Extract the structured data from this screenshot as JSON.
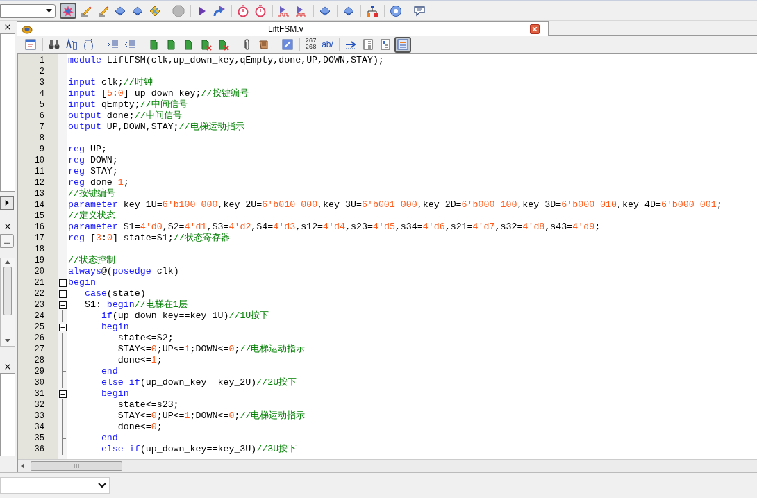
{
  "main_toolbar": {
    "buttons": [
      {
        "selected": true
      },
      {
        "selected": false
      },
      {
        "selected": false
      },
      {
        "selected": false
      },
      {
        "selected": false
      },
      {
        "selected": false
      },
      {
        "selected": false
      },
      {
        "selected": false
      },
      {
        "selected": false
      },
      {
        "selected": false
      },
      {
        "selected": false
      },
      {
        "selected": false
      },
      {
        "selected": false
      },
      {
        "selected": false
      },
      {
        "selected": false
      },
      {
        "selected": false
      },
      {
        "selected": false
      },
      {
        "selected": false
      }
    ]
  },
  "left_panel": {
    "more_button": "..."
  },
  "tab": {
    "title": "LiftFSM.v"
  },
  "editor_toolbar": {
    "buttons": [
      {
        "selected": false
      },
      {
        "selected": false
      },
      {
        "selected": false
      },
      {
        "selected": false
      },
      {
        "selected": false
      },
      {
        "selected": false
      },
      {
        "selected": false
      },
      {
        "selected": false
      },
      {
        "selected": false
      },
      {
        "selected": false
      },
      {
        "selected": false
      },
      {
        "selected": false
      },
      {
        "selected": false
      },
      {
        "selected": false
      },
      {
        "label_lines": [
          "267",
          "268"
        ],
        "selected": false
      },
      {
        "label": "ab/",
        "selected": false
      },
      {
        "selected": false
      },
      {
        "selected": false
      },
      {
        "selected": false
      },
      {
        "selected": true
      }
    ]
  },
  "code_lines": [
    {
      "number": "1",
      "tokens": [
        {
          "kind": "keyword",
          "text": "module"
        },
        {
          "kind": "plain",
          "text": " LiftFSM(clk,up_down_key,qEmpty,done,UP,DOWN,STAY);"
        }
      ]
    },
    {
      "number": "2"
    },
    {
      "number": "3",
      "tokens": [
        {
          "kind": "keyword",
          "text": "input"
        },
        {
          "kind": "plain",
          "text": " clk;"
        },
        {
          "kind": "comment",
          "text": "//时钟"
        }
      ]
    },
    {
      "number": "4",
      "tokens": [
        {
          "kind": "keyword",
          "text": "input"
        },
        {
          "kind": "plain",
          "text": " ["
        },
        {
          "kind": "number",
          "text": "5"
        },
        {
          "kind": "plain",
          "text": ":"
        },
        {
          "kind": "number",
          "text": "0"
        },
        {
          "kind": "plain",
          "text": "] up_down_key;"
        },
        {
          "kind": "comment",
          "text": "//按键编号"
        }
      ]
    },
    {
      "number": "5",
      "tokens": [
        {
          "kind": "keyword",
          "text": "input"
        },
        {
          "kind": "plain",
          "text": " qEmpty;"
        },
        {
          "kind": "comment",
          "text": "//中间信号"
        }
      ]
    },
    {
      "number": "6",
      "tokens": [
        {
          "kind": "keyword",
          "text": "output"
        },
        {
          "kind": "plain",
          "text": " done;"
        },
        {
          "kind": "comment",
          "text": "//中间信号"
        }
      ]
    },
    {
      "number": "7",
      "tokens": [
        {
          "kind": "keyword",
          "text": "output"
        },
        {
          "kind": "plain",
          "text": " UP,DOWN,STAY;"
        },
        {
          "kind": "comment",
          "text": "//电梯运动指示"
        }
      ]
    },
    {
      "number": "8"
    },
    {
      "number": "9",
      "tokens": [
        {
          "kind": "keyword",
          "text": "reg"
        },
        {
          "kind": "plain",
          "text": " UP;"
        }
      ]
    },
    {
      "number": "10",
      "tokens": [
        {
          "kind": "keyword",
          "text": "reg"
        },
        {
          "kind": "plain",
          "text": " DOWN;"
        }
      ]
    },
    {
      "number": "11",
      "tokens": [
        {
          "kind": "keyword",
          "text": "reg"
        },
        {
          "kind": "plain",
          "text": " STAY;"
        }
      ]
    },
    {
      "number": "12",
      "tokens": [
        {
          "kind": "keyword",
          "text": "reg"
        },
        {
          "kind": "plain",
          "text": " done="
        },
        {
          "kind": "number",
          "text": "1"
        },
        {
          "kind": "plain",
          "text": ";"
        }
      ]
    },
    {
      "number": "13",
      "tokens": [
        {
          "kind": "comment",
          "text": "//按键编号"
        }
      ]
    },
    {
      "number": "14",
      "tokens": [
        {
          "kind": "keyword",
          "text": "parameter"
        },
        {
          "kind": "plain",
          "text": " key_1U="
        },
        {
          "kind": "number",
          "text": "6'b100_000"
        },
        {
          "kind": "plain",
          "text": ",key_2U="
        },
        {
          "kind": "number",
          "text": "6'b010_000"
        },
        {
          "kind": "plain",
          "text": ",key_3U="
        },
        {
          "kind": "number",
          "text": "6'b001_000"
        },
        {
          "kind": "plain",
          "text": ",key_2D="
        },
        {
          "kind": "number",
          "text": "6'b000_100"
        },
        {
          "kind": "plain",
          "text": ",key_3D="
        },
        {
          "kind": "number",
          "text": "6'b000_010"
        },
        {
          "kind": "plain",
          "text": ",key_4D="
        },
        {
          "kind": "number",
          "text": "6'b000_001"
        },
        {
          "kind": "plain",
          "text": ";"
        }
      ]
    },
    {
      "number": "15",
      "tokens": [
        {
          "kind": "comment",
          "text": "//定义状态"
        }
      ]
    },
    {
      "number": "16",
      "tokens": [
        {
          "kind": "keyword",
          "text": "parameter"
        },
        {
          "kind": "plain",
          "text": " S1="
        },
        {
          "kind": "number",
          "text": "4'd0"
        },
        {
          "kind": "plain",
          "text": ",S2="
        },
        {
          "kind": "number",
          "text": "4'd1"
        },
        {
          "kind": "plain",
          "text": ",S3="
        },
        {
          "kind": "number",
          "text": "4'd2"
        },
        {
          "kind": "plain",
          "text": ",S4="
        },
        {
          "kind": "number",
          "text": "4'd3"
        },
        {
          "kind": "plain",
          "text": ",s12="
        },
        {
          "kind": "number",
          "text": "4'd4"
        },
        {
          "kind": "plain",
          "text": ",s23="
        },
        {
          "kind": "number",
          "text": "4'd5"
        },
        {
          "kind": "plain",
          "text": ",s34="
        },
        {
          "kind": "number",
          "text": "4'd6"
        },
        {
          "kind": "plain",
          "text": ",s21="
        },
        {
          "kind": "number",
          "text": "4'd7"
        },
        {
          "kind": "plain",
          "text": ",s32="
        },
        {
          "kind": "number",
          "text": "4'd8"
        },
        {
          "kind": "plain",
          "text": ",s43="
        },
        {
          "kind": "number",
          "text": "4'd9"
        },
        {
          "kind": "plain",
          "text": ";"
        }
      ]
    },
    {
      "number": "17",
      "tokens": [
        {
          "kind": "keyword",
          "text": "reg"
        },
        {
          "kind": "plain",
          "text": " ["
        },
        {
          "kind": "number",
          "text": "3"
        },
        {
          "kind": "plain",
          "text": ":"
        },
        {
          "kind": "number",
          "text": "0"
        },
        {
          "kind": "plain",
          "text": "] state=S1;"
        },
        {
          "kind": "comment",
          "text": "//状态寄存器"
        }
      ]
    },
    {
      "number": "18"
    },
    {
      "number": "19",
      "tokens": [
        {
          "kind": "comment",
          "text": "//状态控制"
        }
      ]
    },
    {
      "number": "20",
      "tokens": [
        {
          "kind": "keyword",
          "text": "always"
        },
        {
          "kind": "plain",
          "text": "@("
        },
        {
          "kind": "keyword",
          "text": "posedge"
        },
        {
          "kind": "plain",
          "text": " clk)"
        }
      ]
    },
    {
      "number": "21",
      "fold": {
        "kind": "collapse"
      },
      "tokens": [
        {
          "kind": "keyword",
          "text": "begin"
        }
      ]
    },
    {
      "number": "22",
      "fold": {
        "kind": "collapse"
      },
      "tokens": [
        {
          "kind": "keyword",
          "text": "   case"
        },
        {
          "kind": "plain",
          "text": "(state)"
        }
      ]
    },
    {
      "number": "23",
      "fold": {
        "kind": "collapse"
      },
      "tokens": [
        {
          "kind": "plain",
          "text": "   S1: "
        },
        {
          "kind": "keyword",
          "text": "begin"
        },
        {
          "kind": "comment",
          "text": "//电梯在1层"
        }
      ]
    },
    {
      "number": "24",
      "fold": {
        "kind": "line"
      },
      "tokens": [
        {
          "kind": "keyword",
          "text": "      if"
        },
        {
          "kind": "plain",
          "text": "(up_down_key==key_1U)"
        },
        {
          "kind": "comment",
          "text": "//1U按下"
        }
      ]
    },
    {
      "number": "25",
      "fold": {
        "kind": "collapse"
      },
      "tokens": [
        {
          "kind": "keyword",
          "text": "      begin"
        }
      ]
    },
    {
      "number": "26",
      "fold": {
        "kind": "line"
      },
      "tokens": [
        {
          "kind": "plain",
          "text": "         state<=S2;"
        }
      ]
    },
    {
      "number": "27",
      "fold": {
        "kind": "line"
      },
      "tokens": [
        {
          "kind": "plain",
          "text": "         STAY<="
        },
        {
          "kind": "number",
          "text": "0"
        },
        {
          "kind": "plain",
          "text": ";UP<="
        },
        {
          "kind": "number",
          "text": "1"
        },
        {
          "kind": "plain",
          "text": ";DOWN<="
        },
        {
          "kind": "number",
          "text": "0"
        },
        {
          "kind": "plain",
          "text": ";"
        },
        {
          "kind": "comment",
          "text": "//电梯运动指示"
        }
      ]
    },
    {
      "number": "28",
      "fold": {
        "kind": "line"
      },
      "tokens": [
        {
          "kind": "plain",
          "text": "         done<="
        },
        {
          "kind": "number",
          "text": "1"
        },
        {
          "kind": "plain",
          "text": ";"
        }
      ]
    },
    {
      "number": "29",
      "fold": {
        "kind": "end"
      },
      "tokens": [
        {
          "kind": "keyword",
          "text": "      end"
        }
      ]
    },
    {
      "number": "30",
      "fold": {
        "kind": "line"
      },
      "tokens": [
        {
          "kind": "keyword",
          "text": "      else if"
        },
        {
          "kind": "plain",
          "text": "(up_down_key==key_2U)"
        },
        {
          "kind": "comment",
          "text": "//2U按下"
        }
      ]
    },
    {
      "number": "31",
      "fold": {
        "kind": "collapse"
      },
      "tokens": [
        {
          "kind": "keyword",
          "text": "      begin"
        }
      ]
    },
    {
      "number": "32",
      "fold": {
        "kind": "line"
      },
      "tokens": [
        {
          "kind": "plain",
          "text": "         state<=s23;"
        }
      ]
    },
    {
      "number": "33",
      "fold": {
        "kind": "line"
      },
      "tokens": [
        {
          "kind": "plain",
          "text": "         STAY<="
        },
        {
          "kind": "number",
          "text": "0"
        },
        {
          "kind": "plain",
          "text": ";UP<="
        },
        {
          "kind": "number",
          "text": "1"
        },
        {
          "kind": "plain",
          "text": ";DOWN<="
        },
        {
          "kind": "number",
          "text": "0"
        },
        {
          "kind": "plain",
          "text": ";"
        },
        {
          "kind": "comment",
          "text": "//电梯运动指示"
        }
      ]
    },
    {
      "number": "34",
      "fold": {
        "kind": "line"
      },
      "tokens": [
        {
          "kind": "plain",
          "text": "         done<="
        },
        {
          "kind": "number",
          "text": "0"
        },
        {
          "kind": "plain",
          "text": ";"
        }
      ]
    },
    {
      "number": "35",
      "fold": {
        "kind": "end"
      },
      "tokens": [
        {
          "kind": "keyword",
          "text": "      end"
        }
      ]
    },
    {
      "number": "36",
      "fold": {
        "kind": "line"
      },
      "tokens": [
        {
          "kind": "keyword",
          "text": "      else if"
        },
        {
          "kind": "plain",
          "text": "(up_down_key==key_3U)"
        },
        {
          "kind": "comment",
          "text": "//3U按下"
        }
      ]
    }
  ]
}
